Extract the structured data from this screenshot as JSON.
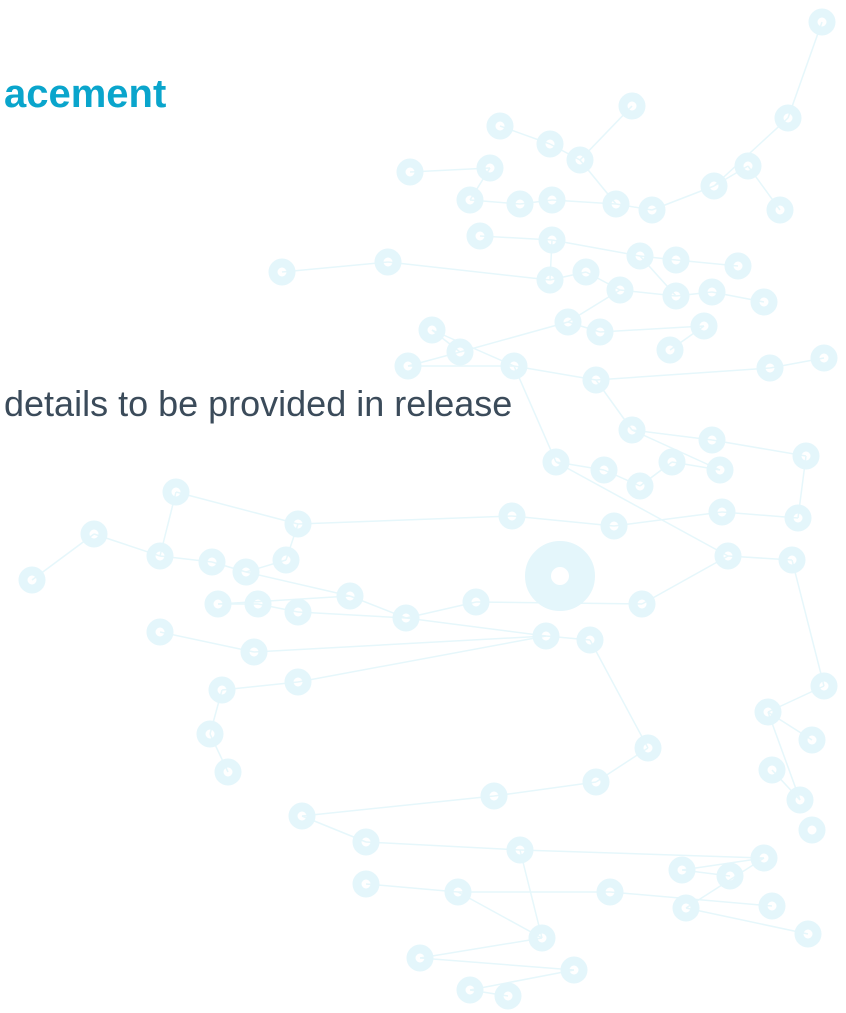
{
  "slide": {
    "title": "acement",
    "body": "details to be provided in release",
    "colors": {
      "title": "#0aa5cc",
      "body": "#3b4b5a",
      "network": "#e4f6fb"
    },
    "decoration": "network-graph-watermark"
  }
}
